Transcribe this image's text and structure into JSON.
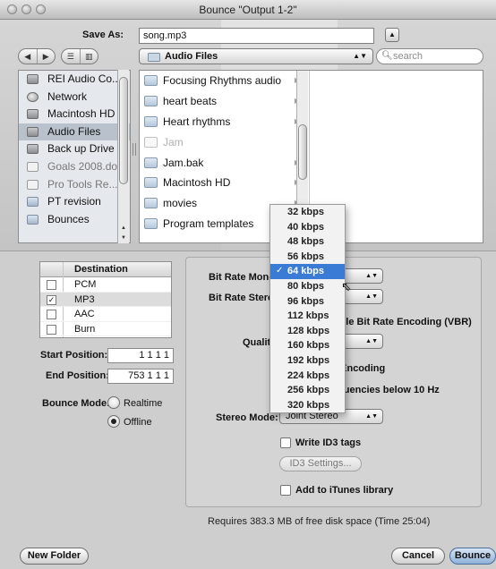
{
  "window": {
    "title": "Bounce \"Output 1-2\""
  },
  "save_as": {
    "label": "Save As:",
    "value": "song.mp3"
  },
  "nav": {
    "location": "Audio Files",
    "search_placeholder": "search"
  },
  "sidebar": {
    "items": [
      {
        "label": "REI Audio Co...",
        "icon": "disk-icon"
      },
      {
        "label": "Network",
        "icon": "network-icon"
      },
      {
        "label": "Macintosh HD",
        "icon": "harddisk-icon"
      },
      {
        "label": "Audio Files",
        "icon": "harddisk-icon",
        "selected": true
      },
      {
        "label": "Back up Drive",
        "icon": "harddisk-icon"
      },
      {
        "label": "Goals 2008.doc",
        "icon": "document-icon",
        "grey": true
      },
      {
        "label": "Pro Tools Re...",
        "icon": "document-icon",
        "grey": true
      },
      {
        "label": "PT revision",
        "icon": "folder-icon"
      },
      {
        "label": "Bounces",
        "icon": "folder-icon"
      }
    ]
  },
  "browser": {
    "items": [
      {
        "label": "Focusing Rhythms audio",
        "folder": true
      },
      {
        "label": "heart beats",
        "folder": true
      },
      {
        "label": "Heart rhythms",
        "folder": true
      },
      {
        "label": "Jam",
        "folder": false,
        "grey": true
      },
      {
        "label": "Jam.bak",
        "folder": true
      },
      {
        "label": "Macintosh HD",
        "folder": true
      },
      {
        "label": "movies",
        "folder": true
      },
      {
        "label": "Program templates",
        "folder": true
      }
    ]
  },
  "destination": {
    "header": "Destination",
    "rows": [
      {
        "label": "PCM",
        "checked": false
      },
      {
        "label": "MP3",
        "checked": true,
        "selected": true
      },
      {
        "label": "AAC",
        "checked": false
      },
      {
        "label": "Burn",
        "checked": false
      }
    ]
  },
  "positions": {
    "start_label": "Start Position:",
    "start_value": "1 1 1 1",
    "end_label": "End Position:",
    "end_value": "753 1 1 1"
  },
  "bounce_mode": {
    "label": "Bounce Mode:",
    "options": [
      "Realtime",
      "Offline"
    ],
    "selected": "Offline"
  },
  "settings": {
    "bit_rate_mono_label": "Bit Rate Mono",
    "bit_rate_stereo_label": "Bit Rate Stereo",
    "vbr_label": "Use Variable Bit Rate Encoding (VBR)",
    "quality_label": "Quality",
    "encoding_label": "Use Best Encoding",
    "filter_label": "Filter Frequencies below 10 Hz",
    "stereo_mode_label": "Stereo Mode:",
    "stereo_mode_value": "Joint Stereo",
    "write_id3_label": "Write ID3 tags",
    "id3_button": "ID3 Settings...",
    "itunes_label": "Add to iTunes library"
  },
  "bitrate_menu": {
    "options": [
      "32 kbps",
      "40 kbps",
      "48 kbps",
      "56 kbps",
      "64 kbps",
      "80 kbps",
      "96 kbps",
      "112 kbps",
      "128 kbps",
      "160 kbps",
      "192 kbps",
      "224 kbps",
      "256 kbps",
      "320 kbps"
    ],
    "selected": "64 kbps"
  },
  "footer": {
    "disk_info": "Requires 383.3 MB of free disk space  (Time 25:04)",
    "new_folder": "New Folder",
    "cancel": "Cancel",
    "bounce": "Bounce"
  }
}
